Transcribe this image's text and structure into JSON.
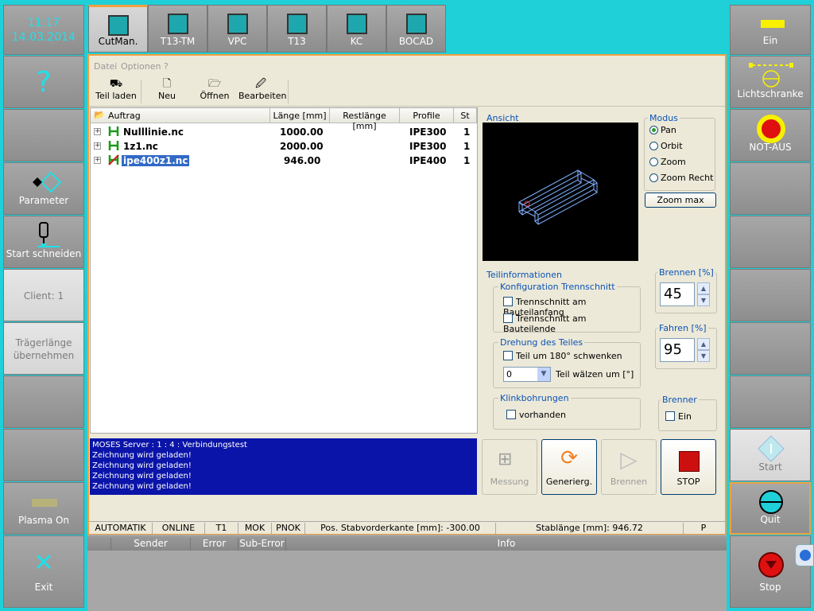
{
  "clock": {
    "time": "11:17",
    "date": "14.03.2014"
  },
  "left": {
    "help": "?",
    "parameter": "Parameter",
    "start_schneiden": "Start schneiden",
    "client": "Client: 1",
    "traegerlaenge": "Trägerlänge übernehmen",
    "plasma_on": "Plasma On",
    "exit": "Exit"
  },
  "tabs": [
    {
      "label": "CutMan."
    },
    {
      "label": "T13-TM"
    },
    {
      "label": "VPC"
    },
    {
      "label": "T13"
    },
    {
      "label": "KC"
    },
    {
      "label": "BOCAD"
    }
  ],
  "menu": {
    "datei": "Datei",
    "optionen": "Optionen",
    "help": "?"
  },
  "toolbar": {
    "teil_laden": "Teil laden",
    "neu": "Neu",
    "oeffnen": "Öffnen",
    "bearbeiten": "Bearbeiten"
  },
  "list": {
    "columns": {
      "auftrag": "Auftrag",
      "laenge": "Länge [mm]",
      "restlaenge": "Restlänge [mm]",
      "profile": "Profile",
      "st": "St"
    },
    "rows": [
      {
        "name": "Nulllinie.nc",
        "laenge": "1000.00",
        "profile": "IPE300",
        "st": "1"
      },
      {
        "name": "1z1.nc",
        "laenge": "2000.00",
        "profile": "IPE300",
        "st": "1"
      },
      {
        "name": "ipe400z1.nc",
        "laenge": "946.00",
        "profile": "IPE400",
        "st": "1"
      }
    ]
  },
  "log": {
    "lines": [
      "MOSES Server : 1 : 4 : Verbindungstest",
      "Zeichnung wird geladen!",
      "Zeichnung wird geladen!",
      "Zeichnung wird geladen!",
      "Zeichnung wird geladen!"
    ]
  },
  "ansicht": {
    "title": "Ansicht"
  },
  "modus": {
    "title": "Modus",
    "pan": "Pan",
    "orbit": "Orbit",
    "zoom": "Zoom",
    "zoom_recht": "Zoom Recht",
    "zoom_max": "Zoom max",
    "selected": "Pan"
  },
  "teilinfo": {
    "title": "Teilinformationen",
    "konfig_title": "Konfiguration Trennschnitt",
    "anfang": "Trennschnitt am Bauteilanfang",
    "ende": "Trennschnitt am Bauteilende",
    "drehung_title": "Drehung des Teiles",
    "schwenken": "Teil um 180° schwenken",
    "walzen_value": "0",
    "walzen": "Teil wälzen um [°]",
    "klink_title": "Klinkbohrungen",
    "vorhanden": "vorhanden"
  },
  "brennen": {
    "title": "Brennen [%]",
    "value": "45"
  },
  "fahren": {
    "title": "Fahren [%]",
    "value": "95"
  },
  "brenner": {
    "title": "Brenner",
    "ein": "Ein"
  },
  "actions": {
    "messung": "Messung",
    "generierg": "Generierg.",
    "brennen": "Brennen",
    "stop": "STOP"
  },
  "status": {
    "mode": "AUTOMATIK",
    "online": "ONLINE",
    "t1": "T1",
    "mok": "MOK",
    "pnok": "PNOK",
    "pos": "Pos. Stabvorderkante [mm]: -300.00",
    "stab": "Stablänge [mm]: 946.72",
    "p": "P"
  },
  "bottom": {
    "sender": "Sender",
    "error": "Error",
    "suberror": "Sub-Error",
    "info": "Info"
  },
  "right": {
    "ein": "Ein",
    "lichtschranke": "Lichtschranke",
    "not_aus": "NOT-AUS",
    "start": "Start",
    "quit": "Quit",
    "stop": "Stop"
  },
  "colors": {
    "accent": "#f0a040",
    "teal": "#1fd0d8",
    "log_bg": "#0a14a8",
    "label_blue": "#0b52b5"
  }
}
